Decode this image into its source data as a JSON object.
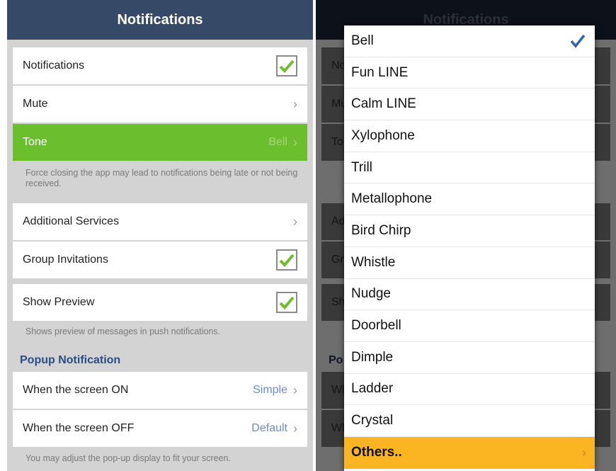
{
  "header": {
    "title": "Notifications"
  },
  "settings": {
    "notifications_label": "Notifications",
    "mute_label": "Mute",
    "tone_label": "Tone",
    "tone_value": "Bell",
    "force_close_note": "Force closing the app may lead to notifications being late or not being received.",
    "additional_services_label": "Additional Services",
    "group_invitations_label": "Group Invitations",
    "show_preview_label": "Show Preview",
    "show_preview_note": "Shows preview of messages in push notifications.",
    "popup_section_title": "Popup Notification",
    "screen_on_label": "When the screen ON",
    "screen_on_value": "Simple",
    "screen_off_label": "When the screen OFF",
    "screen_off_value": "Default",
    "popup_note": "You may adjust the pop-up display to fit your screen."
  },
  "dim_fragments": {
    "r1": "No",
    "r2": "Mu",
    "r3": "To",
    "r4": "Ad",
    "r5": "Gr",
    "r6": "Sh",
    "section": "Po",
    "r7": "Wl",
    "r8": "Wl"
  },
  "tone_menu": {
    "selected": "Bell",
    "items": [
      "Bell",
      "Fun LINE",
      "Calm LINE",
      "Xylophone",
      "Trill",
      "Metallophone",
      "Bird Chirp",
      "Whistle",
      "Nudge",
      "Doorbell",
      "Dimple",
      "Ladder",
      "Crystal"
    ],
    "others_label": "Others.."
  },
  "colors": {
    "header_bg": "#364a67",
    "tone_highlight": "#6bbf2c",
    "checkmark": "#6bbf2c",
    "section_title": "#2b4d86",
    "others_bg": "#fbb523",
    "selected_check": "#2f62b3"
  },
  "checkboxes": {
    "notifications": true,
    "group_invitations": true,
    "show_preview": true
  }
}
